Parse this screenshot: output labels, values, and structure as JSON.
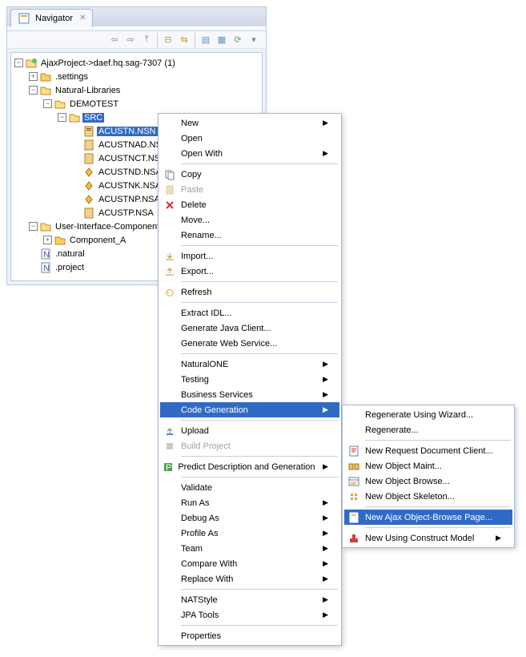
{
  "tab": {
    "title": "Navigator"
  },
  "tree": {
    "root": "AjaxProject->daef.hq.sag-7307 (1)",
    "settings": ".settings",
    "natlib": "Natural-Libraries",
    "demotest": "DEMOTEST",
    "src": "SRC",
    "files": [
      "ACUSTN.NSN",
      "ACUSTNAD.NSA",
      "ACUSTNCT.NSP",
      "ACUSTND.NSA",
      "ACUSTNK.NSA",
      "ACUSTNP.NSA",
      "ACUSTP.NSA"
    ],
    "uic": "User-Interface-Components",
    "compA": "Component_A",
    "natural": ".natural",
    "project": ".project"
  },
  "menu1": {
    "new": "New",
    "open": "Open",
    "openWith": "Open With",
    "copy": "Copy",
    "paste": "Paste",
    "delete": "Delete",
    "move": "Move...",
    "rename": "Rename...",
    "import": "Import...",
    "export": "Export...",
    "refresh": "Refresh",
    "extractIdl": "Extract IDL...",
    "genJava": "Generate Java Client...",
    "genWeb": "Generate Web Service...",
    "naturalOne": "NaturalONE",
    "testing": "Testing",
    "busServ": "Business Services",
    "codeGen": "Code Generation",
    "upload": "Upload",
    "buildProj": "Build Project",
    "predict": "Predict Description and Generation",
    "validate": "Validate",
    "runAs": "Run As",
    "debugAs": "Debug As",
    "profileAs": "Profile As",
    "team": "Team",
    "compareWith": "Compare With",
    "replaceWith": "Replace With",
    "natStyle": "NATStyle",
    "jpaTools": "JPA Tools",
    "properties": "Properties"
  },
  "menu2": {
    "regenWiz": "Regenerate Using Wizard...",
    "regen": "Regenerate...",
    "newReqDoc": "New Request Document Client...",
    "newObjMaint": "New Object Maint...",
    "newObjBrowse": "New Object Browse...",
    "newObjSkel": "New Object Skeleton...",
    "newAjax": "New Ajax Object-Browse Page...",
    "newUsing": "New Using Construct Model"
  }
}
